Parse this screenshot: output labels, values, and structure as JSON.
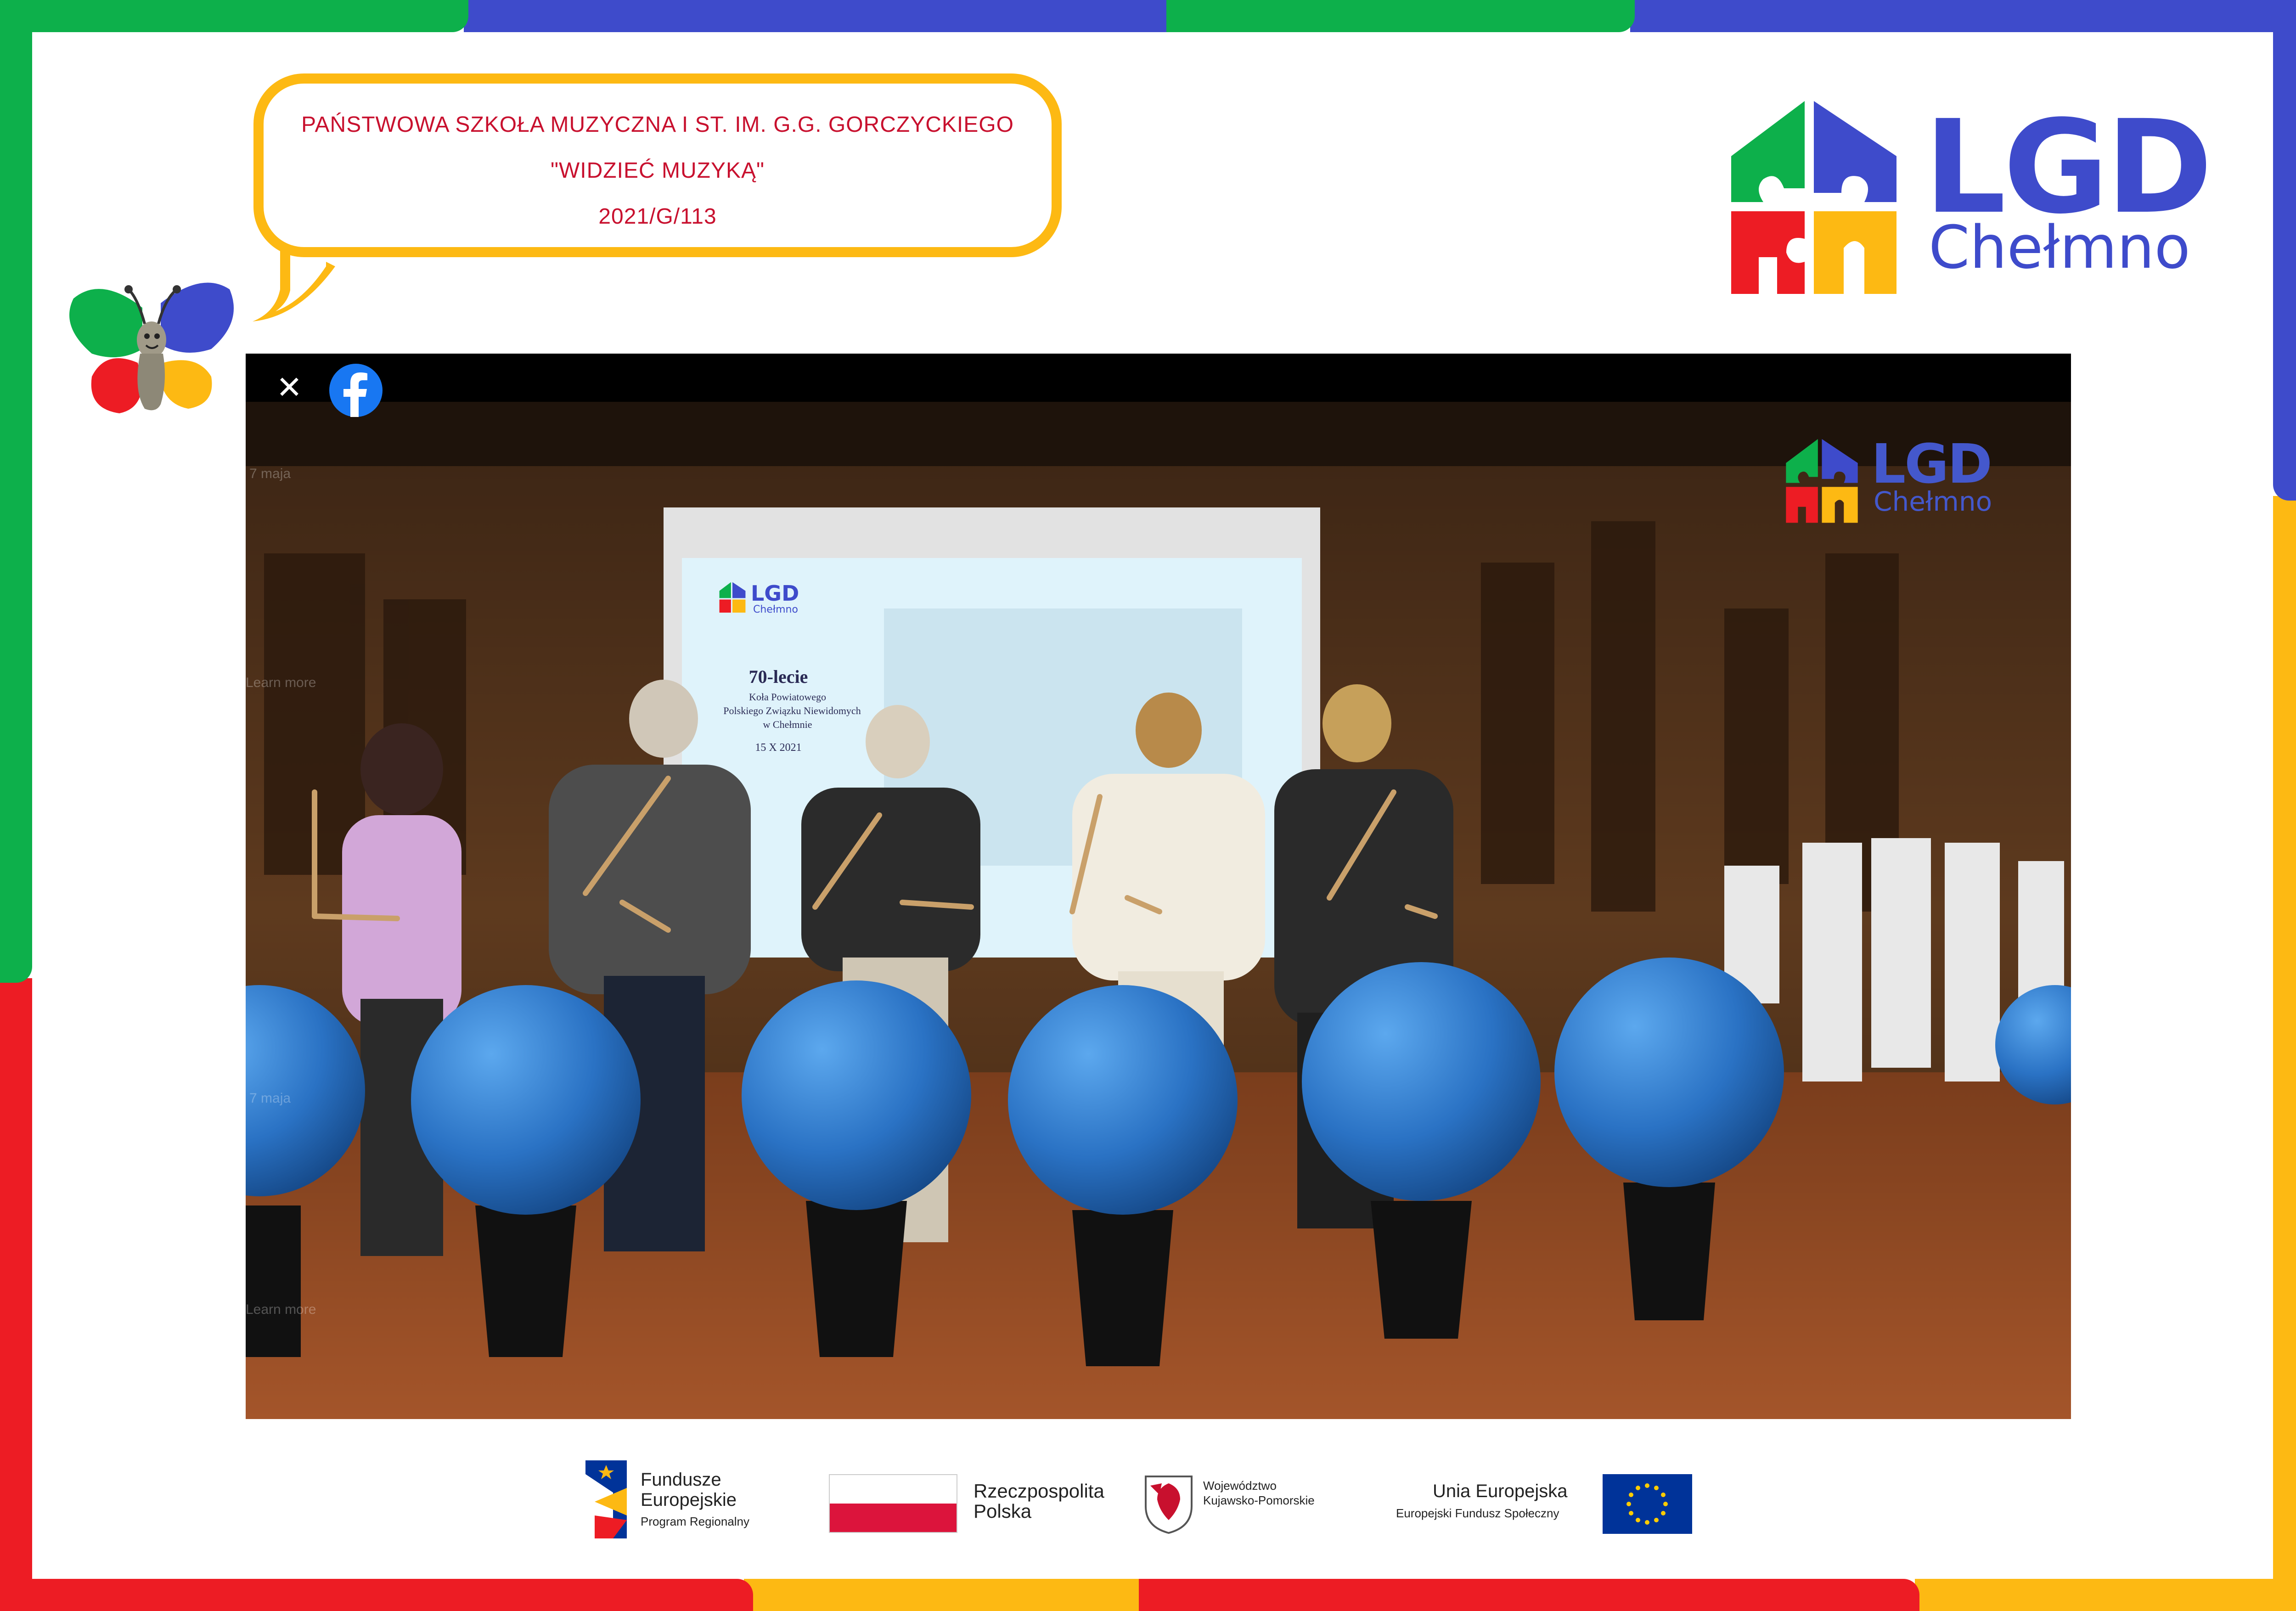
{
  "colors": {
    "green": "#0db04b",
    "blue": "#3e4bcb",
    "red": "#ed1c24",
    "yellow": "#fdb913",
    "bubble_text": "#c8102e"
  },
  "bubble": {
    "line1": "PAŃSTWOWA SZKOŁA MUZYCZNA I ST. IM. G.G. GORCZYCKIEGO",
    "line2": "\"WIDZIEĆ MUZYKĄ\"",
    "line3": "2021/G/113"
  },
  "logo": {
    "title": "LGD",
    "subtitle": "Chełmno"
  },
  "video": {
    "close_icon": "close-icon",
    "share_icon": "facebook-icon",
    "watermark_title": "LGD",
    "watermark_subtitle": "Chełmno",
    "overlay_texts": [
      "7 maja",
      "Learn more",
      "7 maja",
      "Learn more"
    ],
    "screen": {
      "logo_title": "LGD",
      "logo_subtitle": "Chełmno",
      "heading": "70-lecie",
      "line1": "Koła Powiatowego",
      "line2": "Polskiego Związku Niewidomych",
      "line3": "w Chełmnie",
      "date": "15 X 2021"
    }
  },
  "sponsors": {
    "fe_line1": "Fundusze",
    "fe_line2": "Europejskie",
    "fe_line3": "Program Regionalny",
    "rp_line1": "Rzeczpospolita",
    "rp_line2": "Polska",
    "wk_line1": "Województwo",
    "wk_line2": "Kujawsko-Pomorskie",
    "ue_line1": "Unia Europejska",
    "ue_line2": "Europejski Fundusz Społeczny"
  }
}
